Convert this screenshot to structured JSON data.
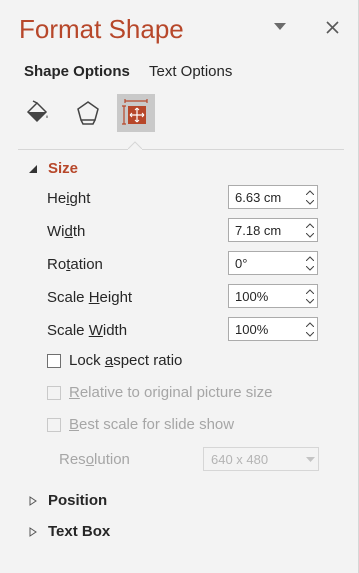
{
  "panel": {
    "title": "Format Shape",
    "tabs": [
      {
        "label": "Shape Options",
        "active": true
      },
      {
        "label": "Text Options",
        "active": false
      }
    ],
    "icon_tabs": [
      {
        "icon": "fill-line-icon",
        "selected": false
      },
      {
        "icon": "effects-icon",
        "selected": false
      },
      {
        "icon": "size-properties-icon",
        "selected": true
      }
    ]
  },
  "size_section": {
    "label": "Size",
    "expanded": true,
    "fields": {
      "height": {
        "prefix": "He",
        "underline": "i",
        "suffix": "ght",
        "value": "6.63 cm"
      },
      "width": {
        "prefix": "Wi",
        "underline": "d",
        "suffix": "th",
        "value": "7.18 cm"
      },
      "rotation": {
        "prefix": "Ro",
        "underline": "t",
        "suffix": "ation",
        "value": "0°"
      },
      "scale_height": {
        "prefix": "Scale ",
        "underline": "H",
        "suffix": "eight",
        "value": "100%"
      },
      "scale_width": {
        "prefix": "Scale ",
        "underline": "W",
        "suffix": "idth",
        "value": "100%"
      }
    },
    "lock_aspect": {
      "prefix": "Lock ",
      "underline": "a",
      "suffix": "spect ratio",
      "checked": false
    },
    "relative_original": {
      "underline": "R",
      "suffix": "elative to original picture size",
      "checked": false,
      "disabled": true
    },
    "best_scale": {
      "underline": "B",
      "suffix": "est scale for slide show",
      "checked": false,
      "disabled": true
    },
    "resolution": {
      "prefix": "Res",
      "underline": "o",
      "suffix": "lution",
      "value": "640 x 480"
    }
  },
  "collapsed_sections": [
    {
      "label": "Position"
    },
    {
      "label": "Text Box"
    }
  ],
  "colors": {
    "accent": "#b7472a",
    "background": "#f3f3f3",
    "selected_icon_bg": "#c9c9c9"
  }
}
